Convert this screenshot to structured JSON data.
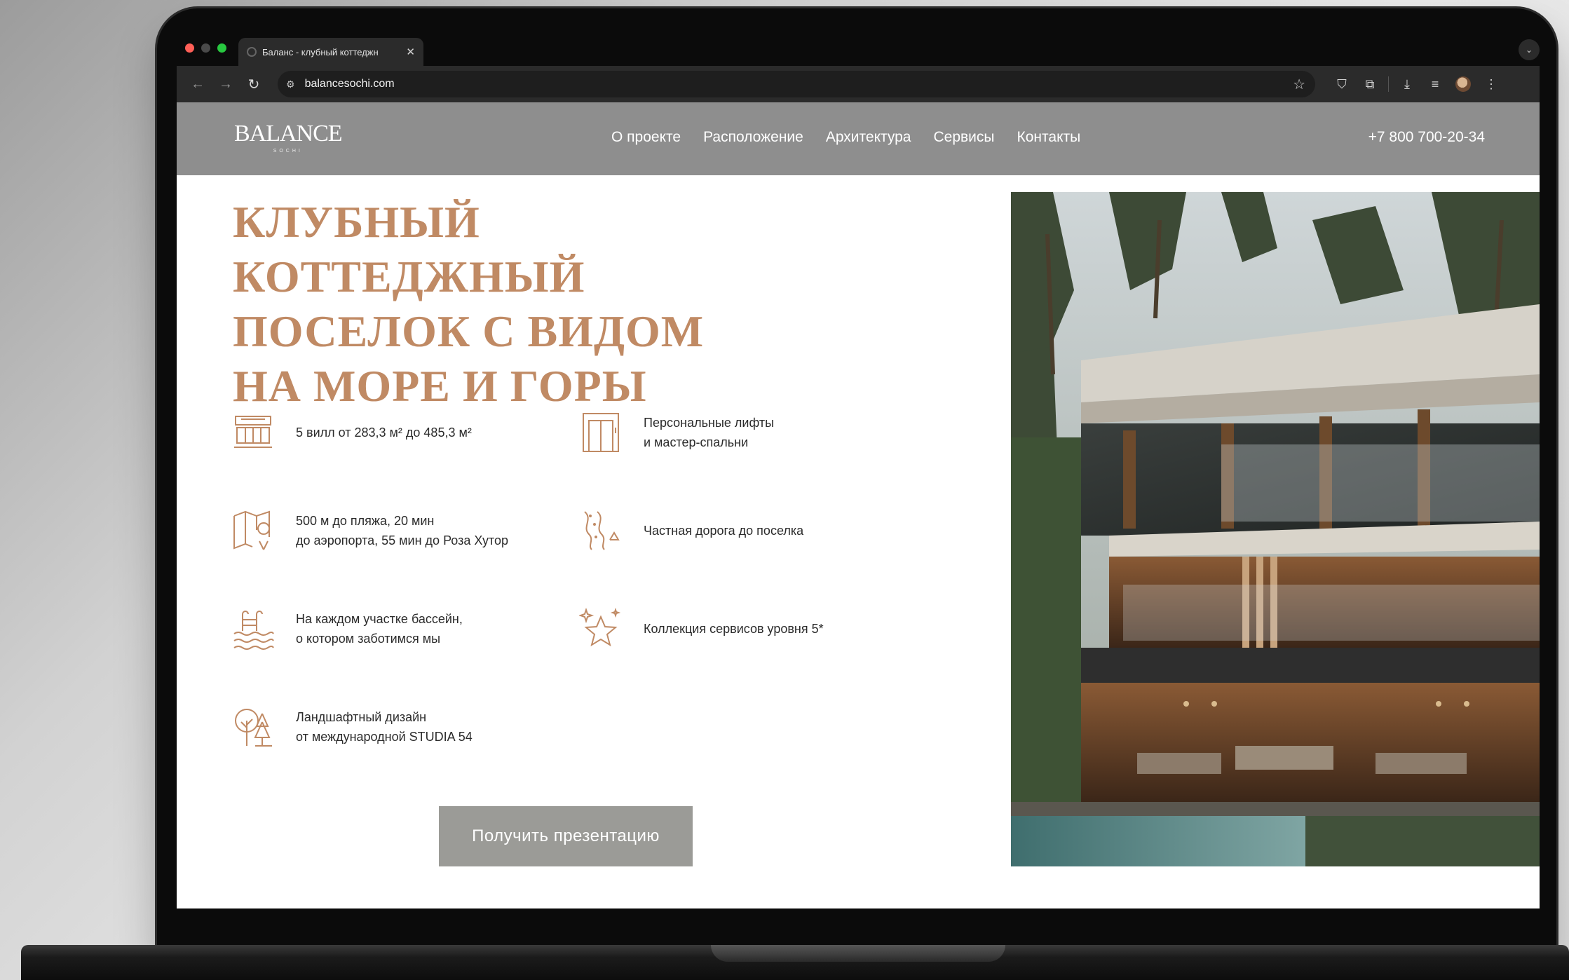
{
  "browser": {
    "tab_title": "Баланс - клубный коттеджн",
    "tab_close": "✕",
    "url": "balancesochi.com"
  },
  "site": {
    "logo": "BALANCE",
    "logo_sub": "SOCHI",
    "nav": [
      "О проекте",
      "Расположение",
      "Архитектура",
      "Сервисы",
      "Контакты"
    ],
    "phone": "+7 800 700-20-34"
  },
  "hero": {
    "title_lines": [
      "КЛУБНЫЙ КОТТЕДЖНЫЙ",
      "ПОСЕЛОК С ВИДОМ",
      "НА МОРЕ И ГОРЫ"
    ],
    "cta": "Получить презентацию"
  },
  "features": [
    {
      "icon": "villa-icon",
      "lines": [
        "5 вилл от 283,3 м² до 485,3 м²"
      ]
    },
    {
      "icon": "elevator-icon",
      "lines": [
        "Персональные лифты",
        "и мастер-спальни"
      ]
    },
    {
      "icon": "map-pin-icon",
      "lines": [
        "500 м до пляжа, 20 мин",
        "до аэропорта, 55 мин до Роза Хутор"
      ]
    },
    {
      "icon": "road-icon",
      "lines": [
        "Частная дорога до поселка"
      ]
    },
    {
      "icon": "pool-icon",
      "lines": [
        "На каждом участке бассейн,",
        "о котором заботимся мы"
      ]
    },
    {
      "icon": "star-icon",
      "lines": [
        "Коллекция сервисов уровня 5*"
      ]
    },
    {
      "icon": "trees-icon",
      "lines": [
        "Ландшафтный дизайн",
        "от международной STUDIA 54"
      ]
    }
  ],
  "colors": {
    "accent": "#c08a64",
    "header_bg": "#8e8e8e",
    "button_bg": "#9b9b97"
  }
}
